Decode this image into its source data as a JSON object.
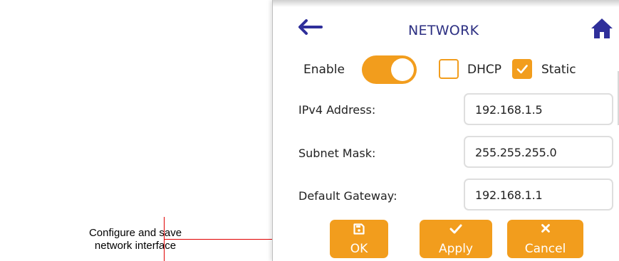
{
  "annotation": {
    "line1": "Configure and save",
    "line2": "network interface"
  },
  "header": {
    "title": "NETWORK",
    "back_icon": "arrow-left-icon",
    "home_icon": "home-icon"
  },
  "mode_row": {
    "enable_label": "Enable",
    "enable_on": true,
    "dhcp_label": "DHCP",
    "dhcp_checked": false,
    "static_label": "Static",
    "static_checked": true
  },
  "fields": {
    "ipv4": {
      "label": "IPv4 Address:",
      "value": "192.168.1.5"
    },
    "subnet": {
      "label": "Subnet Mask:",
      "value": "255.255.255.0"
    },
    "gateway": {
      "label": "Default Gateway:",
      "value": "192.168.1.1"
    }
  },
  "buttons": {
    "ok": {
      "label": "OK",
      "icon": "floppy-disk-icon"
    },
    "apply": {
      "label": "Apply",
      "icon": "checkmark-icon"
    },
    "cancel": {
      "label": "Cancel",
      "icon": "x-mark-icon"
    }
  },
  "colors": {
    "accent": "#f29d1d",
    "title": "#2c2f82",
    "icon_blue": "#2f2f9a",
    "callout_line": "#e00000"
  }
}
